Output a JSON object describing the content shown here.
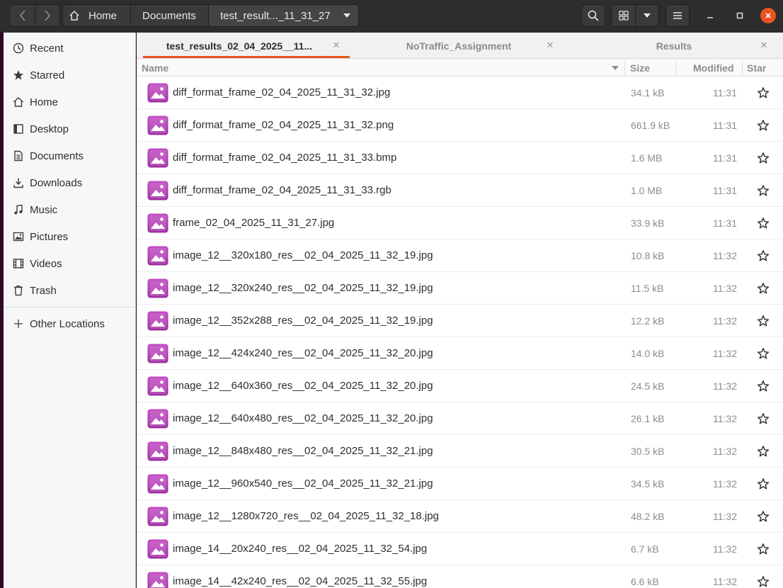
{
  "headerbar": {
    "back_icon": "chevron-left-icon",
    "forward_icon": "chevron-right-icon",
    "breadcrumbs": [
      "Home",
      "Documents",
      "test_result..._11_31_27"
    ],
    "search_icon": "search-icon",
    "view_icon": "grid-view-icon",
    "view_dropdown_icon": "chevron-down-icon",
    "menu_icon": "hamburger-menu-icon",
    "window_controls": [
      "minimize",
      "maximize",
      "close"
    ],
    "close_color": "#e95420"
  },
  "sidebar": {
    "items": [
      {
        "label": "Recent",
        "icon": "clock-icon"
      },
      {
        "label": "Starred",
        "icon": "star-icon"
      },
      {
        "label": "Home",
        "icon": "home-icon"
      },
      {
        "label": "Desktop",
        "icon": "desktop-icon"
      },
      {
        "label": "Documents",
        "icon": "document-icon"
      },
      {
        "label": "Downloads",
        "icon": "download-icon"
      },
      {
        "label": "Music",
        "icon": "music-icon"
      },
      {
        "label": "Pictures",
        "icon": "picture-icon"
      },
      {
        "label": "Videos",
        "icon": "video-icon"
      },
      {
        "label": "Trash",
        "icon": "trash-icon"
      }
    ],
    "other_locations": {
      "label": "Other Locations",
      "icon": "plus-icon"
    }
  },
  "tabs": [
    {
      "label": "test_results_02_04_2025__11...",
      "active": true
    },
    {
      "label": "NoTraffic_Assignment",
      "active": false
    },
    {
      "label": "Results",
      "active": false
    }
  ],
  "accent_color": "#e95420",
  "columns": {
    "name": "Name",
    "size": "Size",
    "modified": "Modified",
    "star": "Star"
  },
  "files": [
    {
      "name": "diff_format_frame_02_04_2025_11_31_32.jpg",
      "size": "34.1 kB",
      "modified": "11:31"
    },
    {
      "name": "diff_format_frame_02_04_2025_11_31_32.png",
      "size": "661.9 kB",
      "modified": "11:31"
    },
    {
      "name": "diff_format_frame_02_04_2025_11_31_33.bmp",
      "size": "1.6 MB",
      "modified": "11:31"
    },
    {
      "name": "diff_format_frame_02_04_2025_11_31_33.rgb",
      "size": "1.0 MB",
      "modified": "11:31"
    },
    {
      "name": "frame_02_04_2025_11_31_27.jpg",
      "size": "33.9 kB",
      "modified": "11:31"
    },
    {
      "name": "image_12__320x180_res__02_04_2025_11_32_19.jpg",
      "size": "10.8 kB",
      "modified": "11:32"
    },
    {
      "name": "image_12__320x240_res__02_04_2025_11_32_19.jpg",
      "size": "11.5 kB",
      "modified": "11:32"
    },
    {
      "name": "image_12__352x288_res__02_04_2025_11_32_19.jpg",
      "size": "12.2 kB",
      "modified": "11:32"
    },
    {
      "name": "image_12__424x240_res__02_04_2025_11_32_20.jpg",
      "size": "14.0 kB",
      "modified": "11:32"
    },
    {
      "name": "image_12__640x360_res__02_04_2025_11_32_20.jpg",
      "size": "24.5 kB",
      "modified": "11:32"
    },
    {
      "name": "image_12__640x480_res__02_04_2025_11_32_20.jpg",
      "size": "26.1 kB",
      "modified": "11:32"
    },
    {
      "name": "image_12__848x480_res__02_04_2025_11_32_21.jpg",
      "size": "30.5 kB",
      "modified": "11:32"
    },
    {
      "name": "image_12__960x540_res__02_04_2025_11_32_21.jpg",
      "size": "34.5 kB",
      "modified": "11:32"
    },
    {
      "name": "image_12__1280x720_res__02_04_2025_11_32_18.jpg",
      "size": "48.2 kB",
      "modified": "11:32"
    },
    {
      "name": "image_14__20x240_res__02_04_2025_11_32_54.jpg",
      "size": "6.7 kB",
      "modified": "11:32"
    },
    {
      "name": "image_14__42x240_res__02_04_2025_11_32_55.jpg",
      "size": "6.6 kB",
      "modified": "11:32"
    }
  ]
}
